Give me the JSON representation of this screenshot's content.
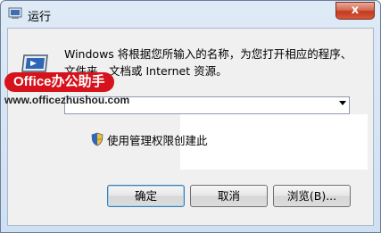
{
  "window": {
    "title": "运行",
    "close_glyph": "x"
  },
  "description_line1": "Windows 将根据您所输入的名称，为您打开相应的程序、",
  "description_line2": "文件夹、文档或 Internet 资源。",
  "open_field": {
    "value": ""
  },
  "admin_option": "使用管理权限创建此",
  "watermark": {
    "brand": "Office办公助手",
    "url": "www.officezhushou.com"
  },
  "buttons": {
    "ok": "确定",
    "cancel": "取消",
    "browse": "浏览(B)..."
  },
  "colors": {
    "close_red": "#c23a1e",
    "watermark_red": "#d6131c",
    "dialog_bg": "#f0f0f0"
  }
}
